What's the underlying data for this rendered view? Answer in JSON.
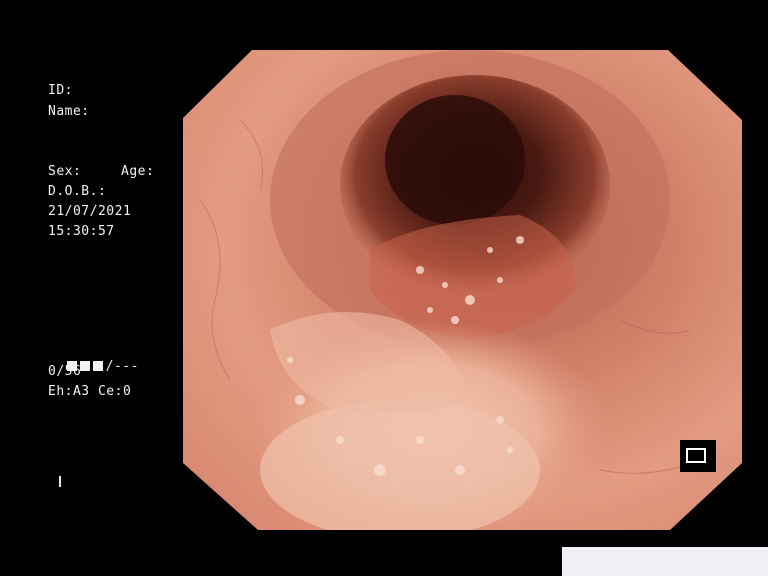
{
  "patient": {
    "id_label": "ID:",
    "name_label": "Name:",
    "sex_label": "Sex:",
    "age_label": "Age:",
    "dob_label": "D.O.B.:",
    "date": "21/07/2021",
    "time": "15:30:57"
  },
  "status": {
    "bars_suffix": "/---",
    "count": "0/56",
    "settings": "Eh:A3 Ce:0",
    "cursor": "I"
  },
  "colors": {
    "background": "#000000",
    "text": "#f2f2f2",
    "mucosa": "#d98570",
    "lumen": "#3a1410"
  },
  "icons": {
    "indicator": "square-outline-icon"
  }
}
